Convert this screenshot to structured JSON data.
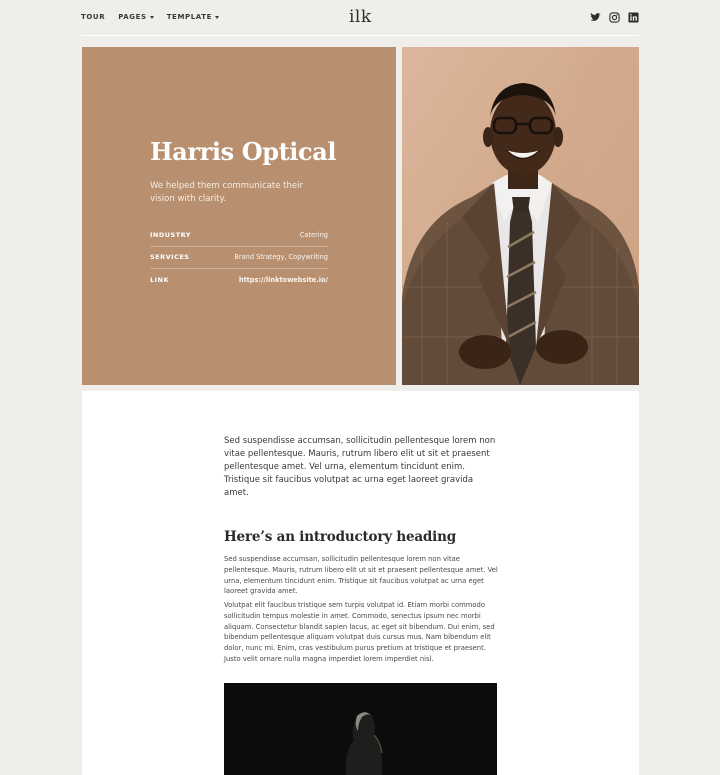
{
  "nav": {
    "items": [
      {
        "label": "TOUR",
        "dropdown": false
      },
      {
        "label": "PAGES",
        "dropdown": true
      },
      {
        "label": "TEMPLATE",
        "dropdown": true
      }
    ],
    "logo": "ilk",
    "social": [
      "twitter-icon",
      "instagram-icon",
      "linkedin-icon"
    ]
  },
  "hero": {
    "title": "Harris Optical",
    "subtitle": "We helped them communicate their vision with clarity.",
    "background": "#b89070",
    "meta": [
      {
        "key": "INDUSTRY",
        "value": "Catering"
      },
      {
        "key": "SERVICES",
        "value": "Brand Strategy, Copywriting"
      },
      {
        "key": "LINK",
        "value": "https://linktowebsite.io/"
      }
    ]
  },
  "content": {
    "lead": "Sed suspendisse accumsan, sollicitudin pellentesque lorem non vitae pellentesque. Mauris, rutrum libero elit ut sit et praesent pellentesque amet. Vel urna, elementum tincidunt enim. Tristique sit faucibus volutpat ac urna eget laoreet gravida amet.",
    "heading": "Here’s an introductory heading",
    "paragraphs": [
      "Sed suspendisse accumsan, sollicitudin pellentesque lorem non vitae pellentesque. Mauris, rutrum libero elit ut sit et praesent pellentesque amet. Vel urna, elementum tincidunt enim. Tristique sit faucibus volutpat ac urna eget laoreet gravida amet.",
      "Volutpat elit faucibus tristique sem turpis volutpat id. Etiam morbi commodo sollicitudin tempus molestie in amet. Commodo, senectus ipsum nec morbi aliquam. Consectetur blandit sapien lacus, ac eget sit bibendum. Dui enim, sed bibendum pellentesque aliquam volutpat duis cursus mus. Nam bibendum elit dolor, nunc mi. Enim, cras vestibulum purus pretium at tristique et praesent. Justo velit ornare nulla magna imperdiet lorem imperdiet nisl."
    ]
  },
  "colors": {
    "page_bg": "#efeeea",
    "accent": "#b89070",
    "text": "#2b2a28"
  }
}
